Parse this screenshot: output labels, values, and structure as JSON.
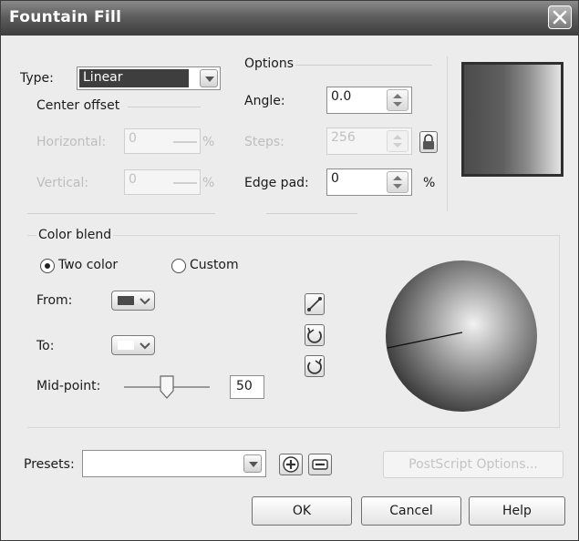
{
  "dialog": {
    "title": "Fountain Fill"
  },
  "type": {
    "label": "Type:",
    "value": "Linear"
  },
  "center_offset": {
    "title": "Center offset",
    "horizontal_label": "Horizontal:",
    "horizontal_value": "0",
    "horizontal_unit": "%",
    "vertical_label": "Vertical:",
    "vertical_value": "0",
    "vertical_unit": "%"
  },
  "options": {
    "title": "Options",
    "angle_label": "Angle:",
    "angle_value": "0.0",
    "steps_label": "Steps:",
    "steps_value": "256",
    "edge_pad_label": "Edge pad:",
    "edge_pad_value": "0",
    "edge_pad_unit": "%"
  },
  "color_blend": {
    "title": "Color blend",
    "two_color_label": "Two color",
    "custom_label": "Custom",
    "selected": "two_color",
    "from_label": "From:",
    "from_color": "#4a4a4a",
    "to_label": "To:",
    "to_color": "#ffffff",
    "midpoint_label": "Mid-point:",
    "midpoint_value": "50",
    "midpoint_fraction": 0.5
  },
  "presets": {
    "label": "Presets:",
    "value": "",
    "postscript_label": "PostScript Options..."
  },
  "buttons": {
    "ok": "OK",
    "cancel": "Cancel",
    "help": "Help"
  },
  "icons": {
    "close": "close-icon",
    "lock": "lock-icon",
    "direct": "direct-line-icon",
    "ccw": "counterclockwise-icon",
    "cw": "clockwise-icon",
    "add": "plus-icon",
    "remove": "minus-icon"
  }
}
